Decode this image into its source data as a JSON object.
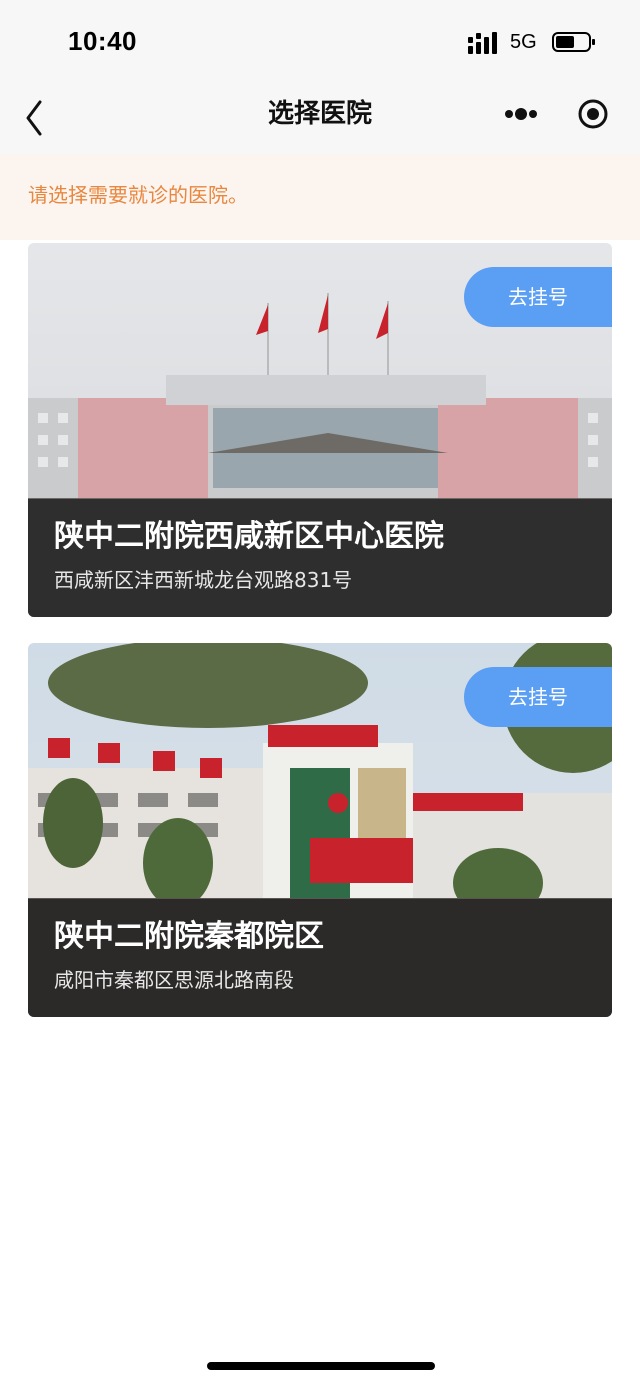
{
  "status_bar": {
    "time": "10:40",
    "network": "5G"
  },
  "nav": {
    "title": "选择医院"
  },
  "notice": {
    "text": "请选择需要就诊的医院。"
  },
  "hospitals": [
    {
      "name": "陕中二附院西咸新区中心医院",
      "address": "西咸新区沣西新城龙台观路831号",
      "book_label": "去挂号"
    },
    {
      "name": "陕中二附院秦都院区",
      "address": "咸阳市秦都区思源北路南段",
      "book_label": "去挂号"
    }
  ],
  "colors": {
    "accent_blue": "#5a9ff3",
    "notice_text": "#e8873f",
    "notice_bg": "#fcf4ee",
    "bar_bg": "#f7f7f7"
  },
  "icons": [
    "signal-icon",
    "battery-icon",
    "back-icon",
    "more-icon",
    "target-icon"
  ]
}
